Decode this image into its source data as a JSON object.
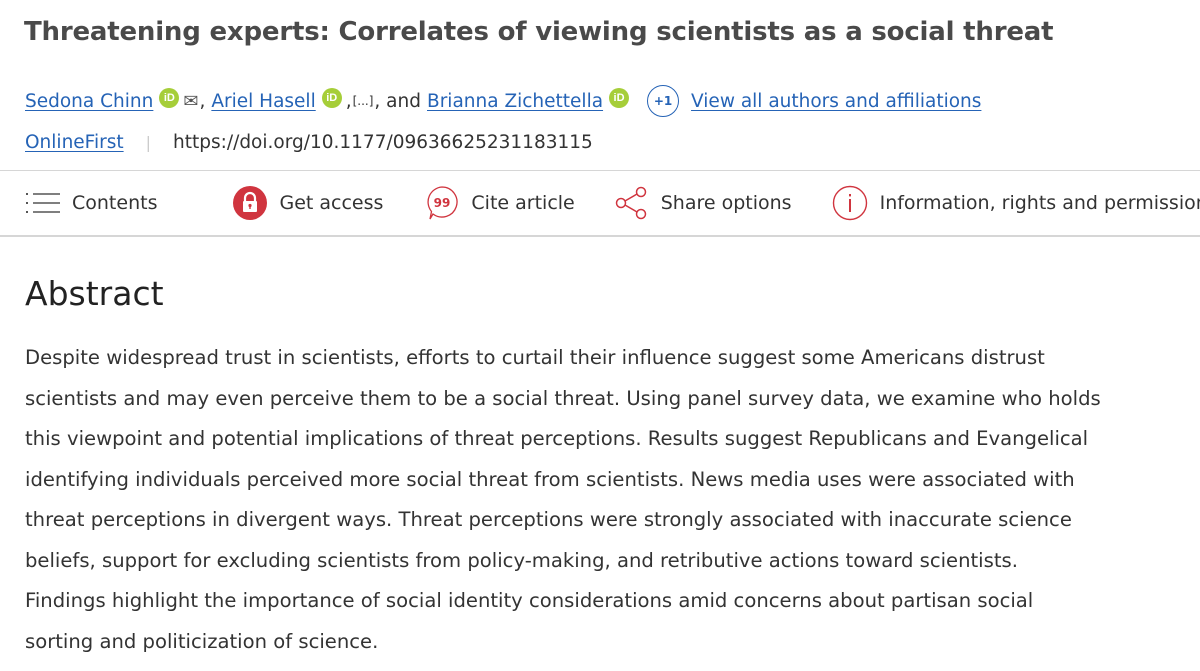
{
  "article": {
    "title": "Threatening experts: Correlates of viewing scientists as a social threat",
    "authors": [
      {
        "name": "Sedona Chinn",
        "orcid": true,
        "email": true
      },
      {
        "name": "Ariel Hasell",
        "orcid": true
      },
      {
        "name": "Brianna Zichettella",
        "orcid": true
      }
    ],
    "orcid_label": "iD",
    "separator_comma": ",",
    "ellipsis": "[...]",
    "and_text": ", and",
    "more_authors_badge": "+1",
    "view_all_link": "View all authors and affiliations",
    "status_link": "OnlineFirst",
    "doi": "https://doi.org/10.1177/09636625231183115"
  },
  "toolbar": {
    "contents": "Contents",
    "get_access": "Get access",
    "cite_article": "Cite article",
    "share_options": "Share options",
    "info_rights": "Information, rights and permissions"
  },
  "abstract": {
    "heading": "Abstract",
    "lines": [
      "Despite widespread trust in scientists, efforts to curtail their influence suggest some Americans distrust",
      "scientists and may even perceive them to be a social threat. Using panel survey data, we examine who holds",
      "this viewpoint and potential implications of threat perceptions. Results suggest Republicans and Evangelical",
      "identifying individuals perceived more social threat from scientists. News media uses were associated with",
      "threat perceptions in divergent ways. Threat perceptions were strongly associated with inaccurate science",
      "beliefs, support for excluding scientists from policy-making, and retributive actions toward scientists.",
      "Findings highlight the importance of social identity considerations amid concerns about partisan social",
      "sorting and politicization of science."
    ]
  },
  "colors": {
    "link": "#2563b6",
    "accent_red": "#d0353f",
    "orcid_green": "#a6ce39"
  }
}
